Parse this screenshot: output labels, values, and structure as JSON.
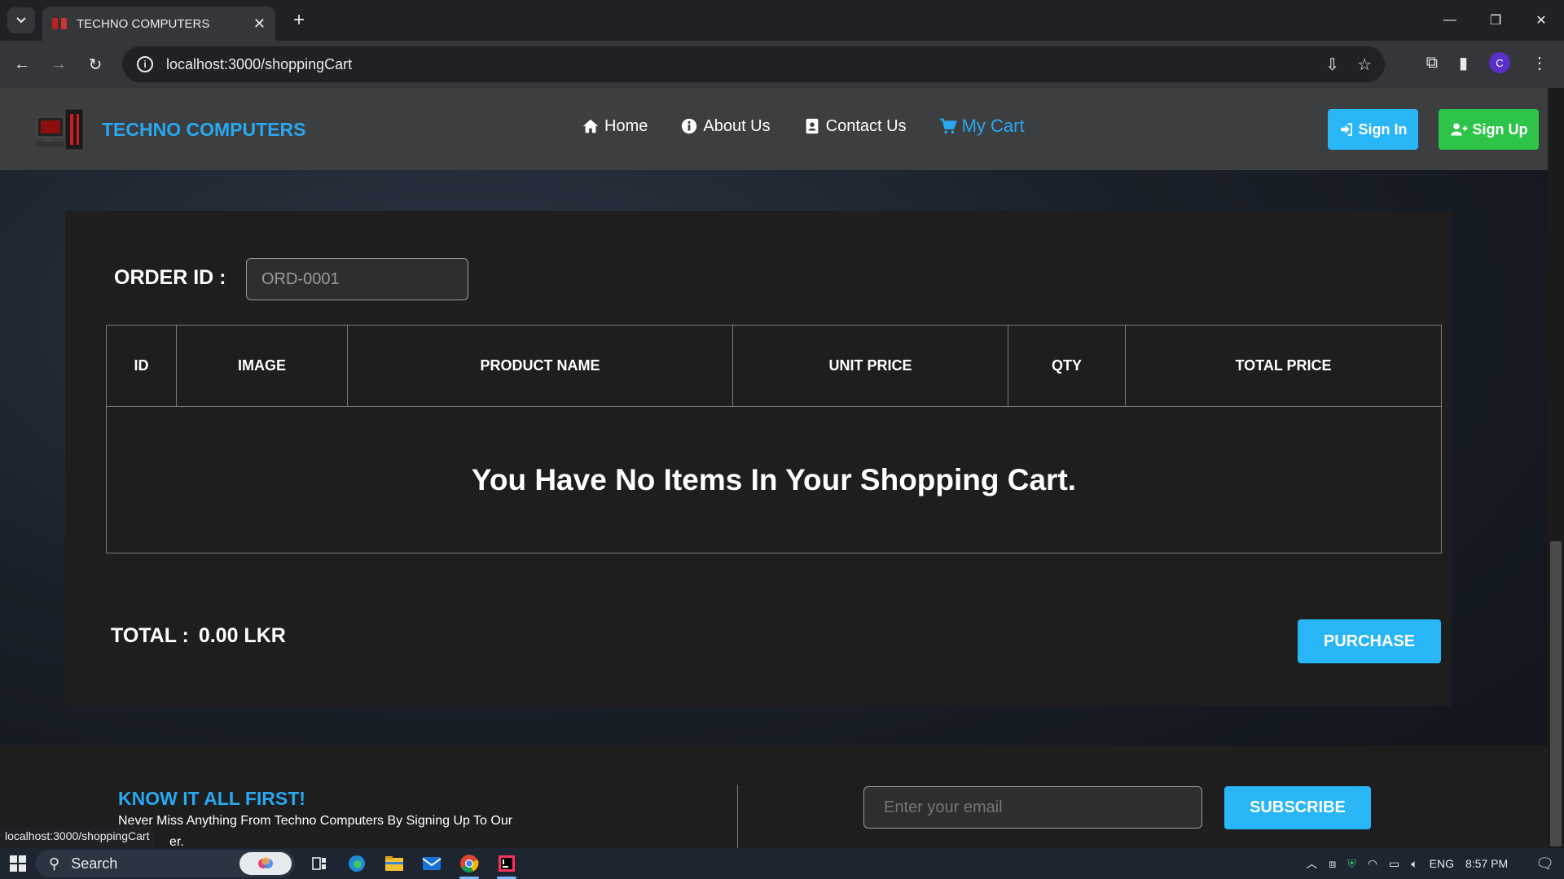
{
  "browser": {
    "tab_title": "TECHNO COMPUTERS",
    "url": "localhost:3000/shoppingCart",
    "status_url": "localhost:3000/shoppingCart",
    "profile_initial": "C"
  },
  "header": {
    "brand": "TECHNO COMPUTERS",
    "nav": {
      "home": "Home",
      "about": "About Us",
      "contact": "Contact Us",
      "cart": "My Cart"
    },
    "sign_in": "Sign In",
    "sign_up": "Sign Up"
  },
  "cart": {
    "order_label": "ORDER ID :",
    "order_id": "ORD-0001",
    "columns": [
      "ID",
      "IMAGE",
      "PRODUCT NAME",
      "UNIT PRICE",
      "QTY",
      "TOTAL PRICE"
    ],
    "empty_message": "You Have No Items In Your Shopping Cart.",
    "total_label": "TOTAL :",
    "total_value": "0.00 LKR",
    "purchase_label": "PURCHASE"
  },
  "newsletter": {
    "title": "KNOW IT ALL FIRST!",
    "text": "Never Miss Anything From Techno Computers By Signing Up To Our",
    "text_cont": "er.",
    "email_placeholder": "Enter your email",
    "subscribe_label": "SUBSCRIBE"
  },
  "taskbar": {
    "search_label": "Search",
    "lang": "ENG",
    "time": "8:57 PM"
  },
  "colors": {
    "accent": "#29b6f6",
    "brand_text": "#29a8f0",
    "signup_green": "#2ec44a"
  }
}
